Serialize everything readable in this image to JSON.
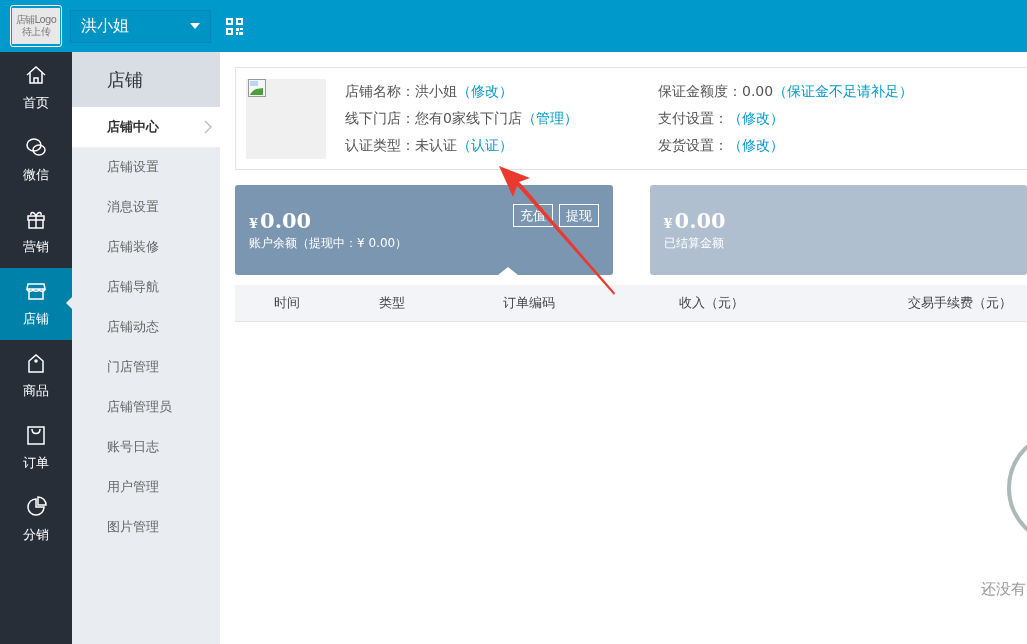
{
  "header": {
    "logo_text": "店铺Logo 待上传",
    "store_name": "洪小姐"
  },
  "nav": [
    {
      "label": "首页",
      "kind": "home",
      "selected": false
    },
    {
      "label": "微信",
      "kind": "chat",
      "selected": false
    },
    {
      "label": "营销",
      "kind": "gift",
      "selected": false
    },
    {
      "label": "店铺",
      "kind": "store",
      "selected": true
    },
    {
      "label": "商品",
      "kind": "tag",
      "selected": false
    },
    {
      "label": "订单",
      "kind": "bag",
      "selected": false
    },
    {
      "label": "分销",
      "kind": "pie",
      "selected": false
    }
  ],
  "submenu": {
    "title": "店铺",
    "items": [
      {
        "label": "店铺中心",
        "selected": true
      },
      {
        "label": "店铺设置",
        "selected": false
      },
      {
        "label": "消息设置",
        "selected": false
      },
      {
        "label": "店铺装修",
        "selected": false
      },
      {
        "label": "店铺导航",
        "selected": false
      },
      {
        "label": "店铺动态",
        "selected": false
      },
      {
        "label": "门店管理",
        "selected": false
      },
      {
        "label": "店铺管理员",
        "selected": false
      },
      {
        "label": "账号日志",
        "selected": false
      },
      {
        "label": "用户管理",
        "selected": false
      },
      {
        "label": "图片管理",
        "selected": false
      }
    ]
  },
  "info": {
    "left": [
      {
        "label": "店铺名称：",
        "value": "洪小姐",
        "link": "（修改）"
      },
      {
        "label": "线下门店：",
        "value": "您有0家线下门店",
        "link": "（管理）"
      },
      {
        "label": "认证类型：",
        "value": "未认证",
        "link": "（认证）"
      }
    ],
    "right": [
      {
        "label": "保证金额度：",
        "value": "0.00",
        "link": "（保证金不足请补足）"
      },
      {
        "label": "支付设置：",
        "link": "（修改）"
      },
      {
        "label": "发货设置：",
        "link": "（修改）"
      }
    ]
  },
  "balance_cards": [
    {
      "currency": "¥",
      "amount": "0.00",
      "caption": "账户余额（提现中：¥ 0.00）",
      "selected": true,
      "buttons": [
        "充值",
        "提现"
      ]
    },
    {
      "currency": "¥",
      "amount": "0.00",
      "caption": "已结算金额",
      "selected": false
    }
  ],
  "table": {
    "columns": [
      "时间",
      "类型",
      "订单编码",
      "收入（元）",
      "交易手续费（元）"
    ]
  },
  "empty_state": {
    "text": "还没有"
  }
}
